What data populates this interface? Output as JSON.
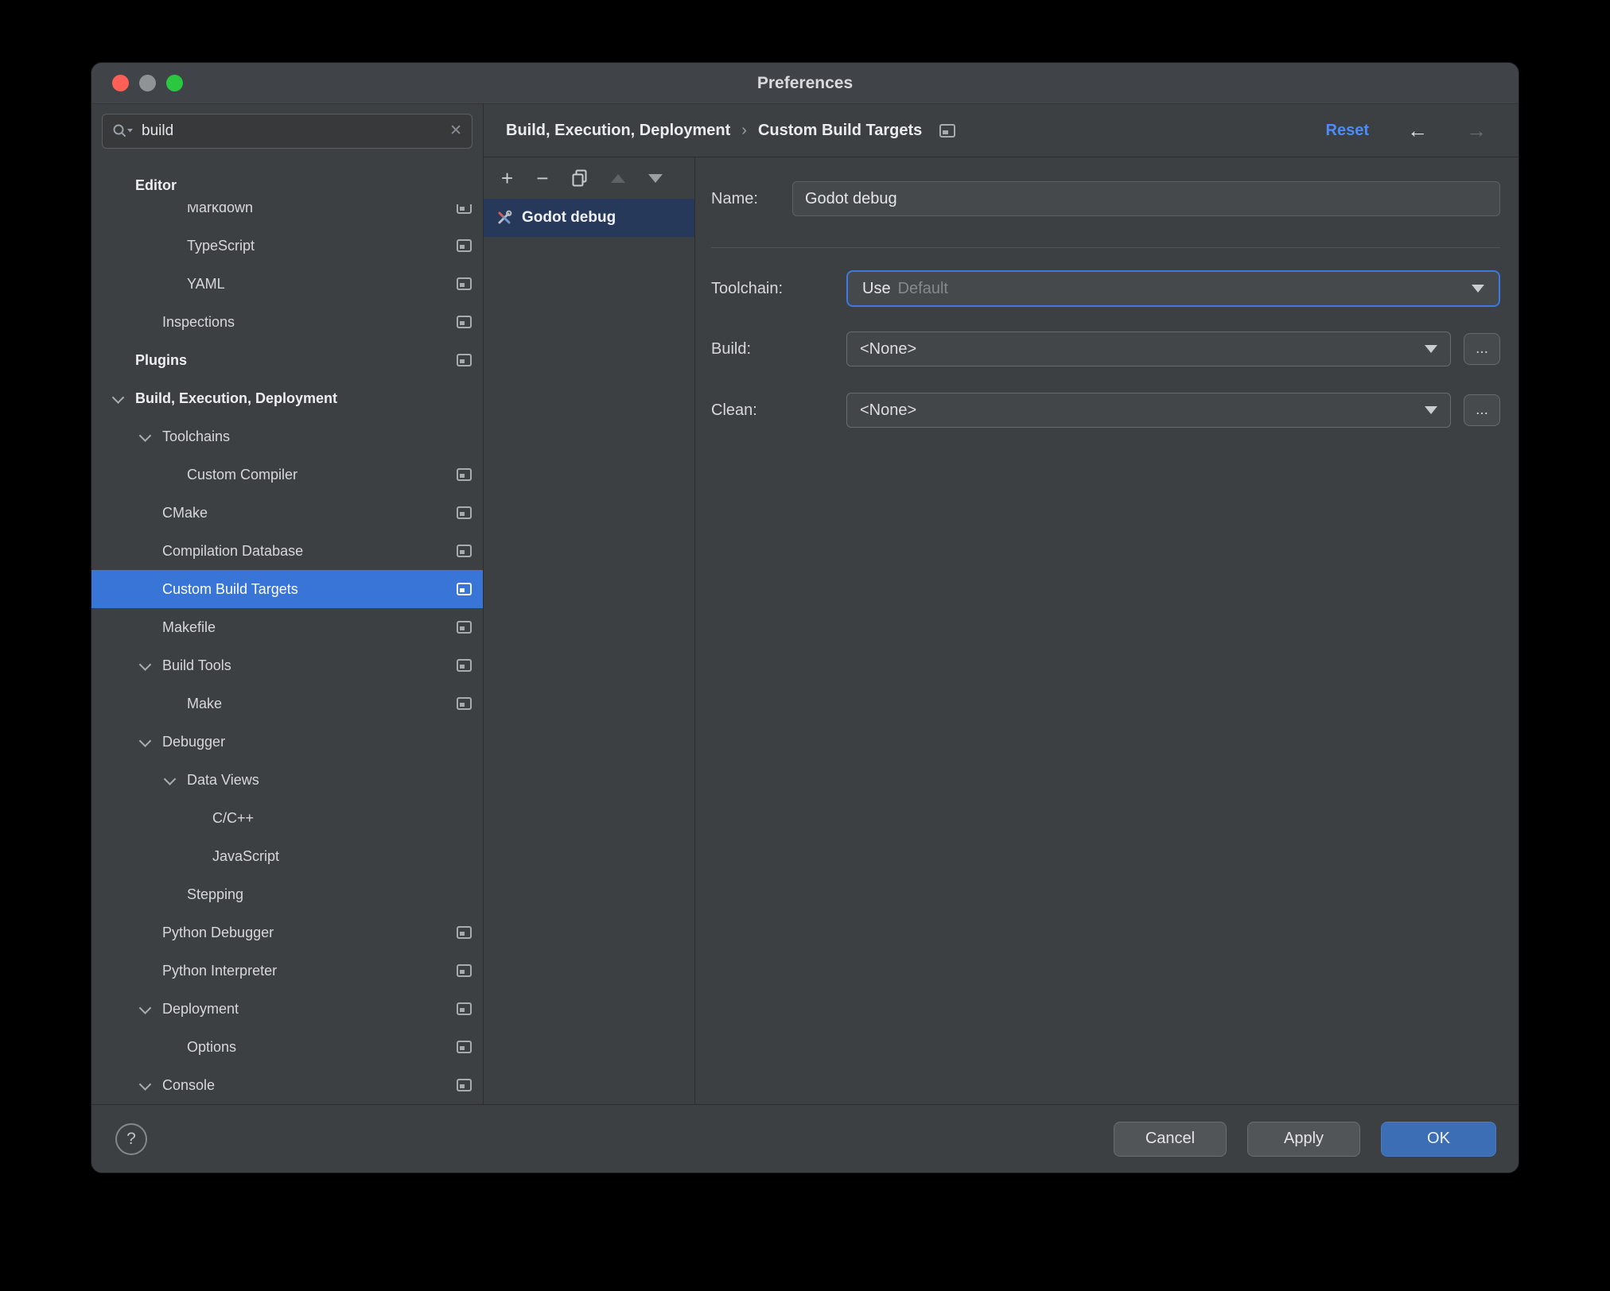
{
  "window": {
    "title": "Preferences"
  },
  "sidebar": {
    "search": {
      "value": "build"
    },
    "tree": [
      {
        "label": "Editor",
        "level": 0,
        "bold": true,
        "sticky": true
      },
      {
        "label": "Markdown",
        "level": 2,
        "icon": true,
        "clipped": true
      },
      {
        "label": "TypeScript",
        "level": 2,
        "icon": true
      },
      {
        "label": "YAML",
        "level": 2,
        "icon": true
      },
      {
        "label": "Inspections",
        "level": 1,
        "icon": true
      },
      {
        "label": "Plugins",
        "level": 0,
        "bold": true,
        "icon": true
      },
      {
        "label": "Build, Execution, Deployment",
        "level": 0,
        "bold": true,
        "chevron": true
      },
      {
        "label": "Toolchains",
        "level": 1,
        "chevron": true
      },
      {
        "label": "Custom Compiler",
        "level": 2,
        "icon": true
      },
      {
        "label": "CMake",
        "level": 1,
        "icon": true
      },
      {
        "label": "Compilation Database",
        "level": 1,
        "icon": true
      },
      {
        "label": "Custom Build Targets",
        "level": 1,
        "icon": true,
        "selected": true
      },
      {
        "label": "Makefile",
        "level": 1,
        "icon": true
      },
      {
        "label": "Build Tools",
        "level": 1,
        "chevron": true,
        "icon": true
      },
      {
        "label": "Make",
        "level": 2,
        "icon": true
      },
      {
        "label": "Debugger",
        "level": 1,
        "chevron": true
      },
      {
        "label": "Data Views",
        "level": 2,
        "chevron": true
      },
      {
        "label": "C/C++",
        "level": 3
      },
      {
        "label": "JavaScript",
        "level": 3
      },
      {
        "label": "Stepping",
        "level": 2
      },
      {
        "label": "Python Debugger",
        "level": 1,
        "icon": true
      },
      {
        "label": "Python Interpreter",
        "level": 1,
        "icon": true
      },
      {
        "label": "Deployment",
        "level": 1,
        "chevron": true,
        "icon": true
      },
      {
        "label": "Options",
        "level": 2,
        "icon": true
      },
      {
        "label": "Console",
        "level": 1,
        "chevron": true,
        "icon": true
      }
    ]
  },
  "breadcrumb": {
    "part1": "Build, Execution, Deployment",
    "separator": "›",
    "part2": "Custom Build Targets"
  },
  "header_actions": {
    "reset": "Reset"
  },
  "icons": {
    "add": "+",
    "remove": "−",
    "clear": "✕",
    "back": "←",
    "forward": "→"
  },
  "targets": {
    "items": [
      {
        "label": "Godot debug",
        "selected": true
      }
    ]
  },
  "form": {
    "name_label": "Name:",
    "name_value": "Godot debug",
    "toolchain_label": "Toolchain:",
    "toolchain_prefix": "Use",
    "toolchain_selected": "Default",
    "build_label": "Build:",
    "build_value": "<None>",
    "clean_label": "Clean:",
    "clean_value": "<None>",
    "more_label": "..."
  },
  "footer": {
    "help_label": "?",
    "cancel_label": "Cancel",
    "apply_label": "Apply",
    "ok_label": "OK"
  },
  "colors": {
    "accent-blue": "#4b8cfa",
    "selection-blue": "#3875d6",
    "list-selection": "#26395b",
    "primary-button": "#3c6eb5",
    "focus-border": "#3d79e0",
    "close-red": "#ff5f57",
    "zoom-green": "#2ac840"
  }
}
